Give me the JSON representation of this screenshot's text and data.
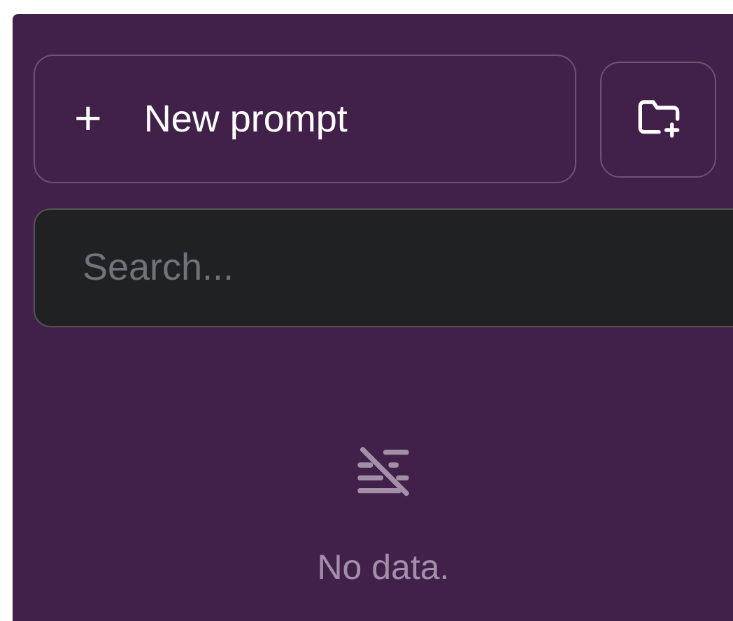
{
  "new_prompt_button": {
    "icon": "+",
    "label": "New prompt"
  },
  "search": {
    "placeholder": "Search..."
  },
  "empty_state": {
    "message": "No data."
  }
}
